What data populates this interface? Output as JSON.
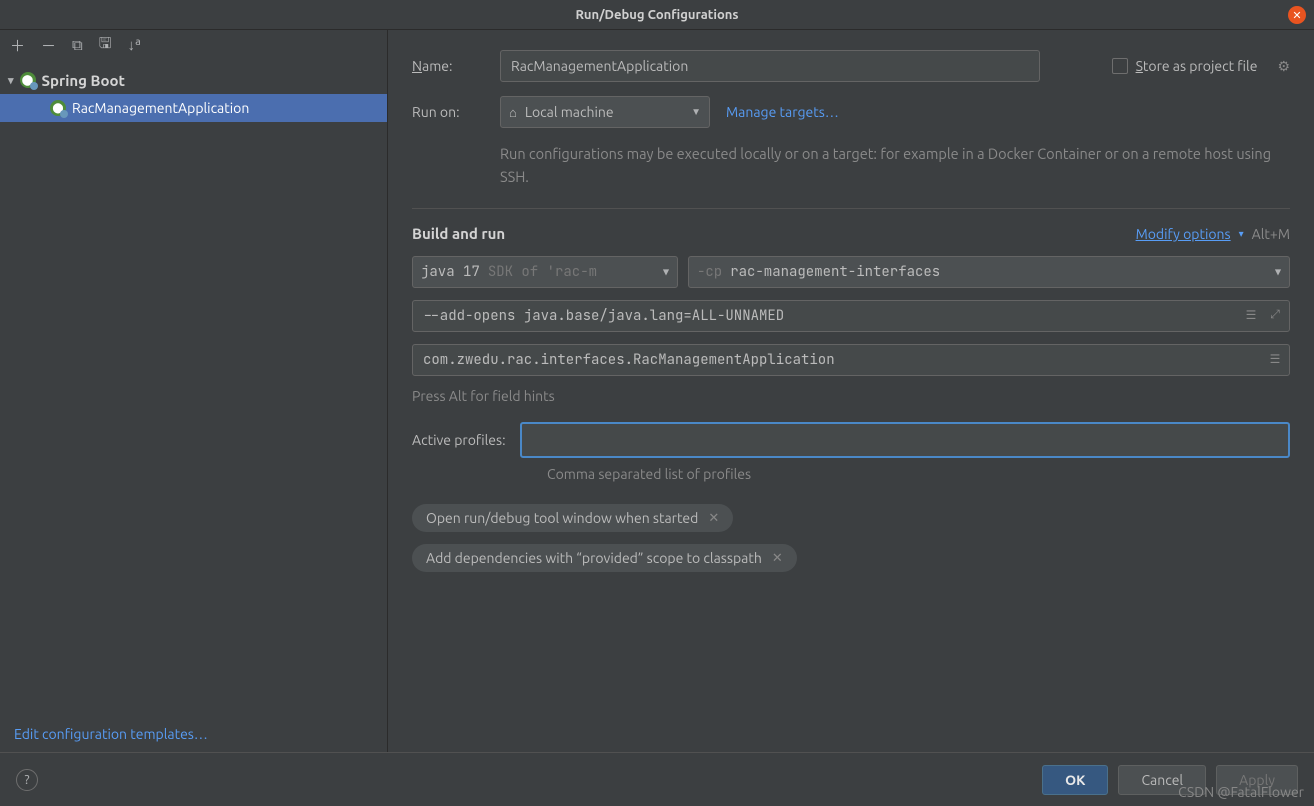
{
  "titlebar": {
    "title": "Run/Debug Configurations"
  },
  "sidebar": {
    "root_label": "Spring Boot",
    "child_label": "RacManagementApplication",
    "edit_templates": "Edit configuration templates"
  },
  "form": {
    "name_label": "Name:",
    "name_value": "RacManagementApplication",
    "store_label": "Store as project file",
    "runon_label": "Run on:",
    "runon_value": "Local machine",
    "manage_targets": "Manage targets",
    "runon_hint": "Run configurations may be executed locally or on a target: for example in a Docker Container or on a remote host using SSH.",
    "build_title": "Build and run",
    "modify_options": "Modify options",
    "modify_shortcut": "Alt+M",
    "jdk_text": "java 17",
    "jdk_hint": "SDK of 'rac-m",
    "cp_prefix": "-cp",
    "cp_value": "rac-management-interfaces",
    "vm_opts": "--add-opens java.base/java.lang=ALL-UNNAMED",
    "main_class": "com.zwedu.rac.interfaces.RacManagementApplication",
    "press_alt": "Press Alt for field hints",
    "profiles_label": "Active profiles:",
    "profiles_value": "",
    "profiles_hint": "Comma separated list of profiles",
    "chip1": "Open run/debug tool window when started",
    "chip2": "Add dependencies with “provided” scope to classpath"
  },
  "buttons": {
    "ok": "OK",
    "cancel": "Cancel",
    "apply": "Apply"
  },
  "watermark": "CSDN @FatalFlower"
}
